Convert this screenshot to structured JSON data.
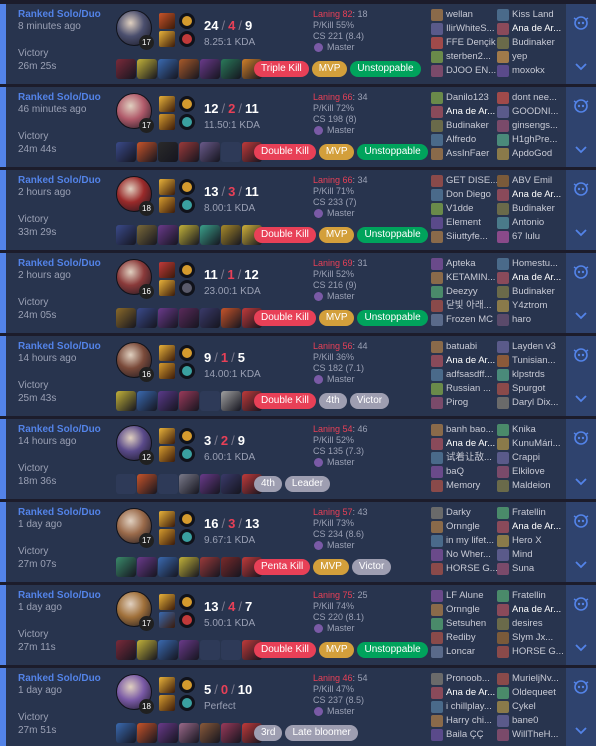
{
  "matches": [
    {
      "queue": "Ranked Solo/Duo",
      "ago": "8 minutes ago",
      "result": "Victory",
      "duration": "26m 25s",
      "level": "17",
      "kills": "24",
      "deaths": "4",
      "assists": "9",
      "ratio": "8.25:1 KDA",
      "laning": "Laning 82",
      "laning_opp": ": 18",
      "pkill": "P/Kill 55%",
      "cs": "CS 221 (8.4)",
      "rank": "Master",
      "champ_color": "#4b4f6e",
      "spell_colors": [
        "#c7542a",
        "#e8b23a"
      ],
      "rune_colors": [
        "#d59b2e",
        "#c13a3a"
      ],
      "item_colors": [
        "#7a2a3a",
        "#c2b23a",
        "#3a6ab0",
        "#a85a2a",
        "#6a3a8a",
        "#2a7a5a",
        "#d0802a"
      ],
      "badges": [
        {
          "label": "Triple Kill",
          "style": "b-red"
        },
        {
          "label": "MVP",
          "style": "b-gold"
        },
        {
          "label": "Unstoppable",
          "style": "b-green"
        }
      ],
      "team1": [
        "wellan",
        "IlirWhiteS...",
        "FFE Dençik",
        "sterben2...",
        "DJOO EN..."
      ],
      "team2": [
        "Kiss Land",
        "Ana de Ar...",
        "Budinaker",
        "yep",
        "moxokx"
      ],
      "team1_colors": [
        "#8a6a4a",
        "#5a5a8a",
        "#a04a4a",
        "#6a8a4a",
        "#7a4a6a"
      ],
      "team2_colors": [
        "#4a6a8a",
        "#8a4a5a",
        "#6a6a4a",
        "#a07a4a",
        "#5a4a8a"
      ],
      "me_team": 2,
      "me_index": 1
    },
    {
      "queue": "Ranked Solo/Duo",
      "ago": "46 minutes ago",
      "result": "Victory",
      "duration": "24m 44s",
      "level": "17",
      "kills": "12",
      "deaths": "2",
      "assists": "11",
      "ratio": "11.50:1 KDA",
      "laning": "Laning 66",
      "laning_opp": ": 34",
      "pkill": "P/Kill 72%",
      "cs": "CS 198 (8)",
      "rank": "Master",
      "champ_color": "#b05a6a",
      "spell_colors": [
        "#e8b23a",
        "#d59b2e"
      ],
      "rune_colors": [
        "#d59b2e",
        "#3aa0a0"
      ],
      "item_colors": [
        "#3a4a8a",
        "#c7542a",
        "#2a2a2a",
        "#9a3a3a",
        "#6a5a8a",
        "#2e3a58",
        "#c13a3a"
      ],
      "badges": [
        {
          "label": "Double Kill",
          "style": "b-red"
        },
        {
          "label": "MVP",
          "style": "b-gold"
        },
        {
          "label": "Unstoppable",
          "style": "b-green"
        }
      ],
      "team1": [
        "Danilo123",
        "Ana de Ar...",
        "Budinaker",
        "Alfredo",
        "AssInFaer"
      ],
      "team2": [
        "dont nee...",
        "GOODNI...",
        "ginsengs...",
        "H1ghPre...",
        "ApdoGod"
      ],
      "team1_colors": [
        "#6a8a4a",
        "#8a4a5a",
        "#6a6a4a",
        "#4a6a8a",
        "#8a6a4a"
      ],
      "team2_colors": [
        "#a04a4a",
        "#5a5a8a",
        "#7a4a6a",
        "#4a8a7a",
        "#8a7a4a"
      ],
      "me_team": 1,
      "me_index": 1
    },
    {
      "queue": "Ranked Solo/Duo",
      "ago": "2 hours ago",
      "result": "Victory",
      "duration": "33m 29s",
      "level": "18",
      "kills": "13",
      "deaths": "3",
      "assists": "11",
      "ratio": "8.00:1 KDA",
      "laning": "Laning 66",
      "laning_opp": ": 34",
      "pkill": "P/Kill 71%",
      "cs": "CS 233 (7)",
      "rank": "Master",
      "champ_color": "#9a2a2a",
      "spell_colors": [
        "#e8b23a",
        "#d59b2e"
      ],
      "rune_colors": [
        "#d59b2e",
        "#3aa0a0"
      ],
      "item_colors": [
        "#3a4a8a",
        "#7a6a3a",
        "#6a3a8a",
        "#c2b23a",
        "#3aa08a",
        "#a88a2a",
        "#d0b23a"
      ],
      "badges": [
        {
          "label": "Double Kill",
          "style": "b-red"
        },
        {
          "label": "MVP",
          "style": "b-gold"
        },
        {
          "label": "Unstoppable",
          "style": "b-green"
        }
      ],
      "team1": [
        "GET DISE...",
        "Don Diego",
        "V1dde",
        "Element",
        "Siiuttyfe..."
      ],
      "team2": [
        "ABV Emil",
        "Ana de Ar...",
        "Budinaker",
        "Antonio",
        "67 lulu"
      ],
      "team1_colors": [
        "#8a4a4a",
        "#4a6a8a",
        "#6a8a4a",
        "#5a4a8a",
        "#8a6a4a"
      ],
      "team2_colors": [
        "#7a5a3a",
        "#8a4a5a",
        "#6a6a4a",
        "#4a7a8a",
        "#8a4a8a"
      ],
      "me_team": 2,
      "me_index": 1
    },
    {
      "queue": "Ranked Solo/Duo",
      "ago": "2 hours ago",
      "result": "Victory",
      "duration": "24m 05s",
      "level": "16",
      "kills": "11",
      "deaths": "1",
      "assists": "12",
      "ratio": "23.00:1 KDA",
      "laning": "Laning 69",
      "laning_opp": ": 31",
      "pkill": "P/Kill 52%",
      "cs": "CS 216 (9)",
      "rank": "Master",
      "champ_color": "#8a3a3a",
      "spell_colors": [
        "#c13a3a",
        "#e8b23a"
      ],
      "rune_colors": [
        "#d59b2e",
        "#5a5a6a"
      ],
      "item_colors": [
        "#8a6a2a",
        "#3a4a8a",
        "#6a3a8a",
        "#5a2a5a",
        "#3a3a6a",
        "#c7542a",
        "#c13a3a"
      ],
      "badges": [
        {
          "label": "Double Kill",
          "style": "b-red"
        },
        {
          "label": "MVP",
          "style": "b-gold"
        },
        {
          "label": "Unstoppable",
          "style": "b-green"
        }
      ],
      "team1": [
        "Apteka",
        "KETAMIN...",
        "Deezyy",
        "닫빛 아래...",
        "Frozen MC"
      ],
      "team2": [
        "Homestu...",
        "Ana de Ar...",
        "Budinaker",
        "Y4ztrom",
        "haro"
      ],
      "team1_colors": [
        "#6a4a8a",
        "#8a6a4a",
        "#4a8a6a",
        "#8a4a4a",
        "#5a6a8a"
      ],
      "team2_colors": [
        "#4a6a8a",
        "#8a4a5a",
        "#6a6a4a",
        "#8a7a4a",
        "#5a4a6a"
      ],
      "me_team": 2,
      "me_index": 1
    },
    {
      "queue": "Ranked Solo/Duo",
      "ago": "14 hours ago",
      "result": "Victory",
      "duration": "25m 43s",
      "level": "16",
      "kills": "9",
      "deaths": "1",
      "assists": "5",
      "ratio": "14.00:1 KDA",
      "laning": "Laning 56",
      "laning_opp": ": 44",
      "pkill": "P/Kill 36%",
      "cs": "CS 182 (7.1)",
      "rank": "Master",
      "champ_color": "#7a4a3a",
      "spell_colors": [
        "#e8b23a",
        "#d59b2e"
      ],
      "rune_colors": [
        "#d59b2e",
        "#3aa0a0"
      ],
      "item_colors": [
        "#c2b23a",
        "#3a6ab0",
        "#5a3a8a",
        "#9a3a5a",
        "#2e3a58",
        "#a0a0a0",
        "#c13a3a"
      ],
      "badges": [
        {
          "label": "Double Kill",
          "style": "b-red"
        },
        {
          "label": "4th",
          "style": "b-gray"
        },
        {
          "label": "Victor",
          "style": "b-gray"
        }
      ],
      "team1": [
        "batuabi",
        "Ana de Ar...",
        "adfsasdff...",
        "Russian ...",
        "Pirog"
      ],
      "team2": [
        "Layden v3",
        "Tunisian...",
        "klpstrds",
        "Spurgot",
        "Daryl Dix..."
      ],
      "team1_colors": [
        "#8a6a4a",
        "#8a4a5a",
        "#4a6a8a",
        "#6a8a4a",
        "#7a4a6a"
      ],
      "team2_colors": [
        "#5a5a8a",
        "#8a5a3a",
        "#4a8a7a",
        "#8a4a4a",
        "#6a6a6a"
      ],
      "me_team": 1,
      "me_index": 1
    },
    {
      "queue": "Ranked Solo/Duo",
      "ago": "14 hours ago",
      "result": "Victory",
      "duration": "18m 36s",
      "level": "12",
      "kills": "3",
      "deaths": "2",
      "assists": "9",
      "ratio": "6.00:1 KDA",
      "laning": "Laning 54",
      "laning_opp": ": 46",
      "pkill": "P/Kill 52%",
      "cs": "CS 135 (7.3)",
      "rank": "Master",
      "champ_color": "#5a4a8a",
      "spell_colors": [
        "#e8b23a",
        "#d59b2e"
      ],
      "rune_colors": [
        "#d59b2e",
        "#3aa0a0"
      ],
      "item_colors": [
        "#2e3a58",
        "#c7542a",
        "#2e3a58",
        "#7a7a8a",
        "#6a3a8a",
        "#3a3a6a",
        "#c13a3a"
      ],
      "badges": [
        {
          "label": "4th",
          "style": "b-gray"
        },
        {
          "label": "Leader",
          "style": "b-gray"
        }
      ],
      "team1": [
        "banh bao...",
        "Ana de Ar...",
        "试着让敌...",
        "baQ",
        "Memory"
      ],
      "team2": [
        "Knika",
        "KunuMári...",
        "Crappi",
        "Elkilove",
        "Maldeion"
      ],
      "team1_colors": [
        "#8a6a4a",
        "#8a4a5a",
        "#4a6a8a",
        "#6a4a8a",
        "#8a4a4a"
      ],
      "team2_colors": [
        "#4a8a6a",
        "#8a7a4a",
        "#5a5a8a",
        "#7a4a6a",
        "#6a6a4a"
      ],
      "me_team": 1,
      "me_index": 1
    },
    {
      "queue": "Ranked Solo/Duo",
      "ago": "1 day ago",
      "result": "Victory",
      "duration": "27m 07s",
      "level": "17",
      "kills": "16",
      "deaths": "3",
      "assists": "13",
      "ratio": "9.67:1 KDA",
      "laning": "Laning 57",
      "laning_opp": ": 43",
      "pkill": "P/Kill 73%",
      "cs": "CS 234 (8.6)",
      "rank": "Master",
      "champ_color": "#9a6a4a",
      "spell_colors": [
        "#e8b23a",
        "#d59b2e"
      ],
      "rune_colors": [
        "#d59b2e",
        "#3aa0a0"
      ],
      "item_colors": [
        "#3a8a6a",
        "#6a3a8a",
        "#3a6ab0",
        "#c2b23a",
        "#9a3a3a",
        "#7a2a2a",
        "#c13a3a"
      ],
      "badges": [
        {
          "label": "Penta Kill",
          "style": "b-red"
        },
        {
          "label": "MVP",
          "style": "b-gold"
        },
        {
          "label": "Victor",
          "style": "b-gray"
        }
      ],
      "team1": [
        "Darky",
        "Ornngle",
        "in my lifet...",
        "No Wher...",
        "HORSE G..."
      ],
      "team2": [
        "Fratellin",
        "Ana de Ar...",
        "Hero X",
        "Mind",
        "Suna"
      ],
      "team1_colors": [
        "#6a6a6a",
        "#8a6a4a",
        "#4a6a8a",
        "#6a4a8a",
        "#8a4a4a"
      ],
      "team2_colors": [
        "#4a8a6a",
        "#8a4a5a",
        "#8a7a4a",
        "#5a5a8a",
        "#7a4a6a"
      ],
      "me_team": 2,
      "me_index": 1
    },
    {
      "queue": "Ranked Solo/Duo",
      "ago": "1 day ago",
      "result": "Victory",
      "duration": "27m 11s",
      "level": "17",
      "kills": "13",
      "deaths": "4",
      "assists": "7",
      "ratio": "5.00:1 KDA",
      "laning": "Laning 75",
      "laning_opp": ": 25",
      "pkill": "P/Kill 74%",
      "cs": "CS 220 (8.1)",
      "rank": "Master",
      "champ_color": "#a0703a",
      "spell_colors": [
        "#e8b23a",
        "#3a6ab0"
      ],
      "rune_colors": [
        "#d59b2e",
        "#c13a3a"
      ],
      "item_colors": [
        "#7a2a3a",
        "#c2b23a",
        "#3a6ab0",
        "#6a3a8a",
        "#2e3a58",
        "#2e3a58",
        "#c13a3a"
      ],
      "badges": [
        {
          "label": "Double Kill",
          "style": "b-red"
        },
        {
          "label": "MVP",
          "style": "b-gold"
        },
        {
          "label": "Unstoppable",
          "style": "b-green"
        }
      ],
      "team1": [
        "LF Alune",
        "Ornngle",
        "Setsuhen",
        "Rediby",
        "Loncar"
      ],
      "team2": [
        "Fratellin",
        "Ana de Ar...",
        "desires",
        "Slym Jx...",
        "HORSE G..."
      ],
      "team1_colors": [
        "#6a4a8a",
        "#8a6a4a",
        "#4a8a6a",
        "#8a4a4a",
        "#5a6a8a"
      ],
      "team2_colors": [
        "#4a8a6a",
        "#8a4a5a",
        "#6a6a4a",
        "#7a5a3a",
        "#8a4a4a"
      ],
      "me_team": 2,
      "me_index": 1
    },
    {
      "queue": "Ranked Solo/Duo",
      "ago": "1 day ago",
      "result": "Victory",
      "duration": "27m 51s",
      "level": "18",
      "kills": "5",
      "deaths": "0",
      "assists": "10",
      "ratio": "Perfect",
      "laning": "Laning 46",
      "laning_opp": ": 54",
      "pkill": "P/Kill 47%",
      "cs": "CS 237 (8.5)",
      "rank": "Master",
      "champ_color": "#7a5aa6",
      "spell_colors": [
        "#e8b23a",
        "#d59b2e"
      ],
      "rune_colors": [
        "#d59b2e",
        "#3aa0a0"
      ],
      "item_colors": [
        "#3a6ab0",
        "#c7542a",
        "#6a3a8a",
        "#9a6a8a",
        "#8a5a3a",
        "#9a3a5a",
        "#c13a3a"
      ],
      "badges": [
        {
          "label": "3rd",
          "style": "b-gray"
        },
        {
          "label": "Late bloomer",
          "style": "b-gray"
        }
      ],
      "team1": [
        "Pronoob...",
        "Ana de Ar...",
        "i chillplay...",
        "Harry chi...",
        "Baila ÇÇ"
      ],
      "team2": [
        "MurieljNv...",
        "Oldequeet",
        "Cykel",
        "bane0",
        "WillTheH..."
      ],
      "team1_colors": [
        "#6a6a6a",
        "#8a4a5a",
        "#4a6a8a",
        "#8a6a4a",
        "#5a4a8a"
      ],
      "team2_colors": [
        "#8a4a4a",
        "#4a8a6a",
        "#8a7a4a",
        "#5a5a8a",
        "#7a4a6a"
      ],
      "me_team": 1,
      "me_index": 1
    }
  ],
  "icons": {
    "action": "ai-bot-icon",
    "expand": "chevron-down-icon",
    "tier": "master-tier-icon"
  },
  "colors": {
    "accent": "#5383e8",
    "row_bg": "#28344e",
    "loss_red": "#e84057",
    "mvp_gold": "#d39f3b",
    "green": "#00a35c"
  }
}
